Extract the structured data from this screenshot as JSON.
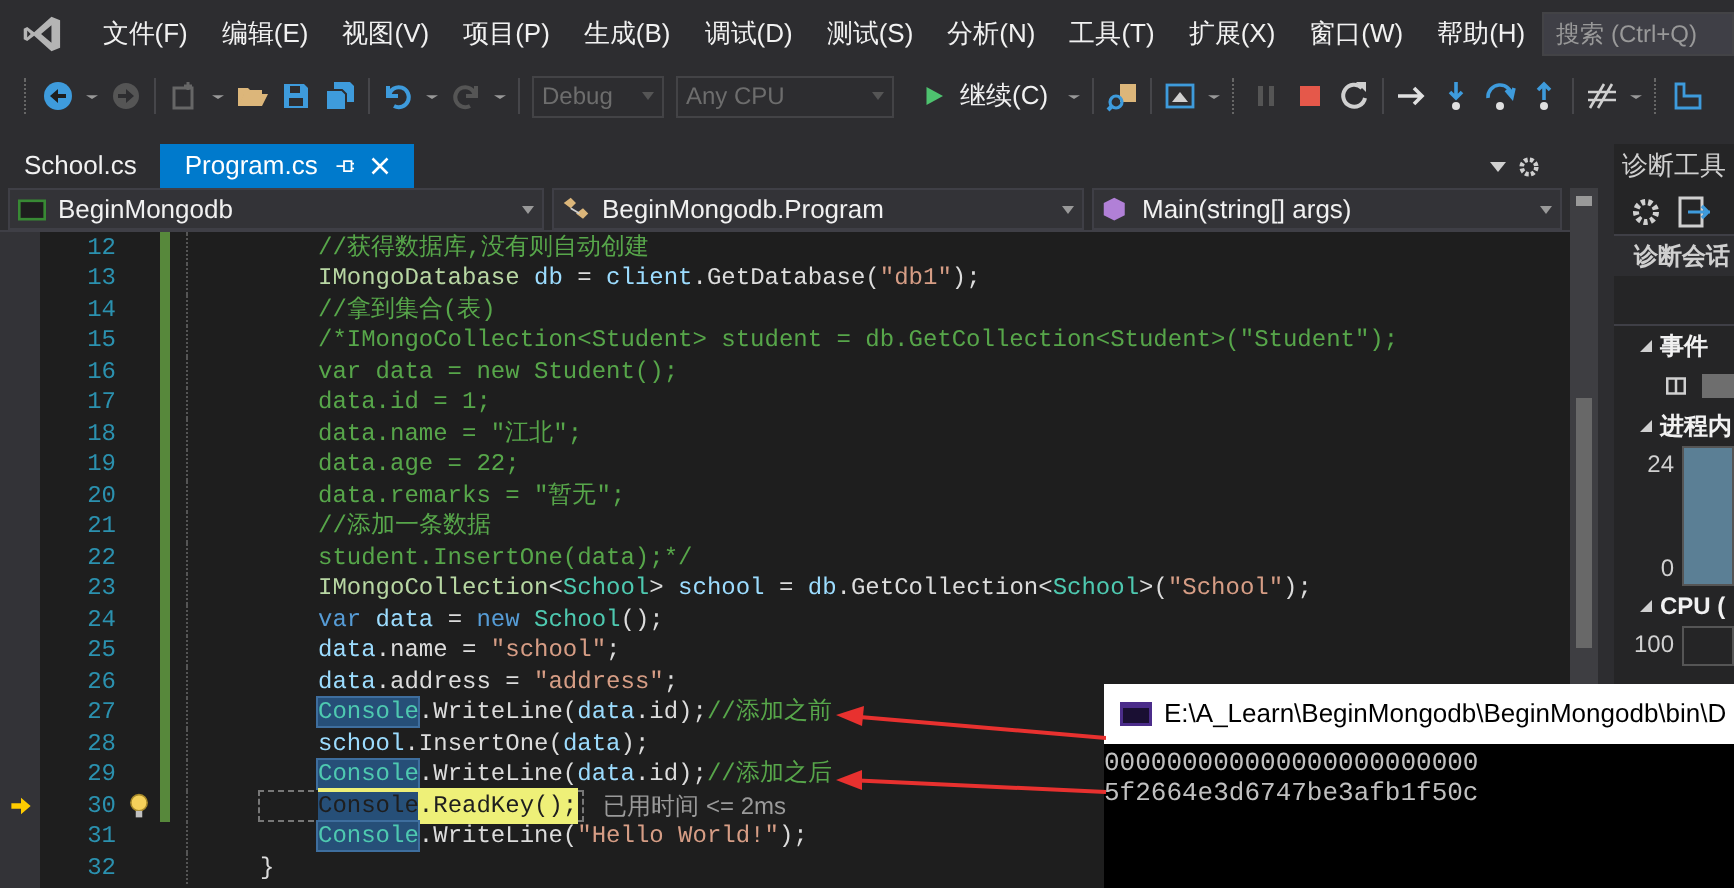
{
  "menu": {
    "items": [
      "文件(F)",
      "编辑(E)",
      "视图(V)",
      "项目(P)",
      "生成(B)",
      "调试(D)",
      "测试(S)",
      "分析(N)",
      "工具(T)",
      "扩展(X)",
      "窗口(W)",
      "帮助(H)"
    ],
    "search": {
      "placeholder": "搜索 (Ctrl+Q)"
    }
  },
  "toolbar": {
    "configuration": {
      "value": "Debug",
      "disabled": true
    },
    "platform": {
      "value": "Any CPU",
      "disabled": true
    },
    "continue_button": "继续(C)"
  },
  "tabs": [
    {
      "label": "School.cs",
      "selected": false
    },
    {
      "label": "Program.cs",
      "selected": true
    }
  ],
  "navigation": {
    "project": "BeginMongodb",
    "class": "BeginMongodb.Program",
    "member": "Main(string[] args)"
  },
  "editor": {
    "lines": [
      {
        "number": "12",
        "kind": "statement",
        "changed": true,
        "current": false,
        "tokens": [
          {
            "kind": "comment",
            "text": "//获得数据库,没有则自动创建"
          }
        ]
      },
      {
        "number": "13",
        "kind": "statement",
        "changed": true,
        "current": false,
        "tokens": [
          {
            "kind": "interface",
            "text": "IMongoDatabase"
          },
          {
            "kind": "var",
            "text": " db"
          },
          {
            "kind": "plain",
            "text": " = "
          },
          {
            "kind": "var",
            "text": "client"
          },
          {
            "kind": "plain",
            "text": ".GetDatabase("
          },
          {
            "kind": "string",
            "text": "\"db1\""
          },
          {
            "kind": "plain",
            "text": ");"
          }
        ]
      },
      {
        "number": "14",
        "kind": "statement",
        "changed": true,
        "current": false,
        "tokens": [
          {
            "kind": "comment",
            "text": "//拿到集合(表)"
          }
        ]
      },
      {
        "number": "15",
        "kind": "statement",
        "changed": true,
        "current": false,
        "tokens": [
          {
            "kind": "comment",
            "text": "/*IMongoCollection<Student> student = db.GetCollection<Student>(\"Student\");"
          }
        ]
      },
      {
        "number": "16",
        "kind": "statement",
        "changed": true,
        "current": false,
        "tokens": [
          {
            "kind": "comment",
            "text": "var data = new Student();"
          }
        ]
      },
      {
        "number": "17",
        "kind": "statement",
        "changed": true,
        "current": false,
        "tokens": [
          {
            "kind": "comment",
            "text": "data.id = 1;"
          }
        ]
      },
      {
        "number": "18",
        "kind": "statement",
        "changed": true,
        "current": false,
        "tokens": [
          {
            "kind": "comment",
            "text": "data.name = \"江北\";"
          }
        ]
      },
      {
        "number": "19",
        "kind": "statement",
        "changed": true,
        "current": false,
        "tokens": [
          {
            "kind": "comment",
            "text": "data.age = 22;"
          }
        ]
      },
      {
        "number": "20",
        "kind": "statement",
        "changed": true,
        "current": false,
        "tokens": [
          {
            "kind": "comment",
            "text": "data.remarks = \"暂无\";"
          }
        ]
      },
      {
        "number": "21",
        "kind": "statement",
        "changed": true,
        "current": false,
        "tokens": [
          {
            "kind": "comment",
            "text": "//添加一条数据"
          }
        ]
      },
      {
        "number": "22",
        "kind": "statement",
        "changed": true,
        "current": false,
        "tokens": [
          {
            "kind": "comment",
            "text": "student.InsertOne(data);*/"
          }
        ]
      },
      {
        "number": "23",
        "kind": "statement",
        "changed": true,
        "current": false,
        "tokens": [
          {
            "kind": "interface",
            "text": "IMongoCollection"
          },
          {
            "kind": "plain",
            "text": "<"
          },
          {
            "kind": "type",
            "text": "School"
          },
          {
            "kind": "plain",
            "text": "> "
          },
          {
            "kind": "var",
            "text": "school"
          },
          {
            "kind": "plain",
            "text": " = "
          },
          {
            "kind": "var",
            "text": "db"
          },
          {
            "kind": "plain",
            "text": ".GetCollection<"
          },
          {
            "kind": "type",
            "text": "School"
          },
          {
            "kind": "plain",
            "text": ">("
          },
          {
            "kind": "string",
            "text": "\"School\""
          },
          {
            "kind": "plain",
            "text": ");"
          }
        ]
      },
      {
        "number": "24",
        "kind": "statement",
        "changed": true,
        "current": false,
        "tokens": [
          {
            "kind": "keyword",
            "text": "var"
          },
          {
            "kind": "var",
            "text": " data"
          },
          {
            "kind": "plain",
            "text": " = "
          },
          {
            "kind": "keyword",
            "text": "new"
          },
          {
            "kind": "type",
            "text": " School"
          },
          {
            "kind": "plain",
            "text": "();"
          }
        ]
      },
      {
        "number": "25",
        "kind": "statement",
        "changed": true,
        "current": false,
        "tokens": [
          {
            "kind": "var",
            "text": "data"
          },
          {
            "kind": "plain",
            "text": ".name = "
          },
          {
            "kind": "string",
            "text": "\"school\""
          },
          {
            "kind": "plain",
            "text": ";"
          }
        ]
      },
      {
        "number": "26",
        "kind": "statement",
        "changed": true,
        "current": false,
        "tokens": [
          {
            "kind": "var",
            "text": "data"
          },
          {
            "kind": "plain",
            "text": ".address = "
          },
          {
            "kind": "string",
            "text": "\"address\""
          },
          {
            "kind": "plain",
            "text": ";"
          }
        ]
      },
      {
        "number": "27",
        "kind": "statement",
        "changed": true,
        "current": false,
        "tokens": [
          {
            "kind": "ref",
            "text": "Console"
          },
          {
            "kind": "plain",
            "text": ".WriteLine("
          },
          {
            "kind": "var",
            "text": "data"
          },
          {
            "kind": "plain",
            "text": ".id);"
          },
          {
            "kind": "comment",
            "text": "//添加之前"
          }
        ]
      },
      {
        "number": "28",
        "kind": "statement",
        "changed": true,
        "current": false,
        "tokens": [
          {
            "kind": "var",
            "text": "school"
          },
          {
            "kind": "plain",
            "text": ".InsertOne("
          },
          {
            "kind": "var",
            "text": "data"
          },
          {
            "kind": "plain",
            "text": ");"
          }
        ]
      },
      {
        "number": "29",
        "kind": "statement",
        "changed": true,
        "current": false,
        "tokens": [
          {
            "kind": "ref",
            "text": "Console"
          },
          {
            "kind": "plain",
            "text": ".WriteLine("
          },
          {
            "kind": "var",
            "text": "data"
          },
          {
            "kind": "plain",
            "text": ".id);"
          },
          {
            "kind": "comment",
            "text": "//添加之后"
          }
        ]
      },
      {
        "number": "30",
        "kind": "statement",
        "changed": true,
        "current": true,
        "hint": "已用时间 <= 2ms",
        "tokens": [
          {
            "kind": "ref",
            "text": "Console"
          },
          {
            "kind": "plain",
            "text": ".ReadKey();"
          }
        ]
      },
      {
        "number": "31",
        "kind": "statement",
        "changed": false,
        "current": false,
        "tokens": [
          {
            "kind": "ref",
            "text": "Console"
          },
          {
            "kind": "plain",
            "text": ".WriteLine("
          },
          {
            "kind": "string",
            "text": "\"Hello World!\""
          },
          {
            "kind": "plain",
            "text": ");"
          }
        ]
      },
      {
        "number": "32",
        "kind": "brace",
        "changed": false,
        "current": false,
        "tokens": [
          {
            "kind": "plain",
            "text": "}"
          }
        ]
      }
    ]
  },
  "console_window": {
    "title": "E:\\A_Learn\\BeginMongodb\\BeginMongodb\\bin\\D",
    "output": [
      "000000000000000000000000",
      "5f2664e3d6747be3afb1f50c"
    ]
  },
  "diagnostic_tools": {
    "title": "诊断工具",
    "session": "诊断会话",
    "sections": [
      {
        "title": "事件",
        "expanded": true
      },
      {
        "title": "进程内",
        "expanded": true,
        "max": "24",
        "min": "0"
      },
      {
        "title": "CPU (",
        "expanded": true,
        "max": "100"
      }
    ]
  }
}
